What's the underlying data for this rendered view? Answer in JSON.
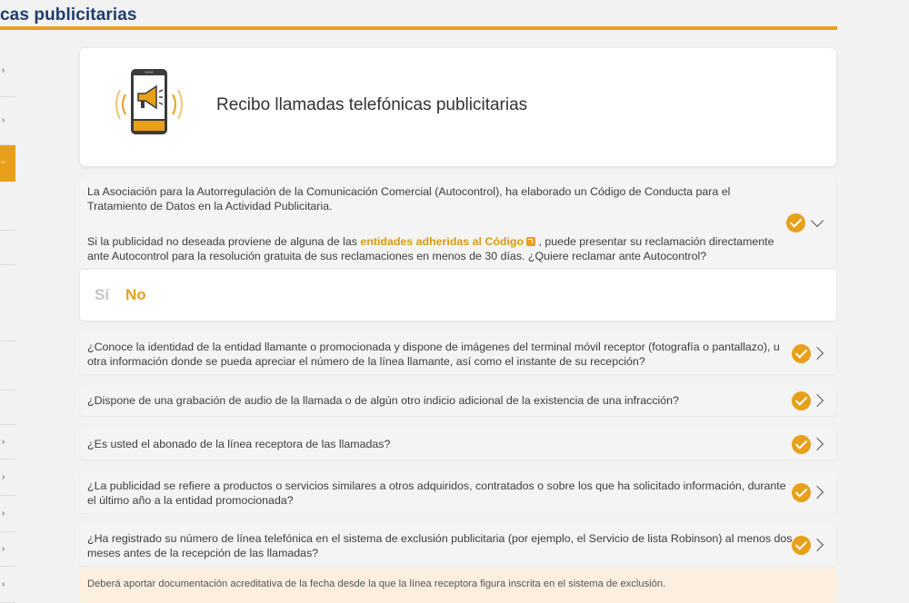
{
  "header": {
    "title": "cas publicitarias"
  },
  "sidebar": {
    "items": [
      {
        "chevron": "›"
      },
      {
        "chevron": "›"
      },
      {
        "chevron": "›",
        "active": true
      },
      {
        "chevron": ""
      },
      {
        "chevron": ""
      },
      {
        "chevron": ""
      },
      {
        "chevron": ""
      },
      {
        "chevron": ""
      },
      {
        "chevron": "›"
      },
      {
        "chevron": "›"
      },
      {
        "chevron": "›"
      },
      {
        "chevron": "›"
      },
      {
        "chevron": "›"
      }
    ]
  },
  "hero": {
    "title": "Recibo llamadas telefónicas publicitarias",
    "icon": "phone-megaphone-icon"
  },
  "intro": {
    "line1": "La Asociación para la Autorregulación de la Comunicación Comercial (Autocontrol), ha elaborado un Código de Conducta para el",
    "line2": "Tratamiento de Datos en la Actividad Publicitaria.",
    "line3_before": "Si la publicidad no deseada proviene de alguna de las ",
    "link": "entidades adheridas al Código",
    "line3_after": " , puede presentar su reclamación directamente",
    "line4": "ante Autocontrol para la resolución gratuita de sus reclamaciones en menos de 30 días. ¿Quiere reclamar ante Autocontrol?"
  },
  "answer": {
    "si": "Sí",
    "no": "No",
    "selected": "No"
  },
  "questions": [
    {
      "line1": "¿Conoce la identidad de la entidad llamante o promocionada y dispone de imágenes del terminal móvil receptor (fotografía o pantallazo), u",
      "line2": "otra información donde se pueda apreciar el número de la línea llamante, así como el instante de su recepción?"
    },
    {
      "line1": "¿Dispone de una grabación de audio de la llamada o de algún otro indicio adicional de la existencia de una infracción?",
      "line2": ""
    },
    {
      "line1": "¿Es usted el abonado de la línea receptora de las llamadas?",
      "line2": ""
    },
    {
      "line1": "¿La publicidad se refiere a productos o servicios similares a otros adquiridos, contratados o sobre los que ha solicitado información, durante",
      "line2": "el último año a la entidad promocionada?"
    },
    {
      "line1": "¿Ha registrado su número de línea telefónica en el sistema de exclusión publicitaria (por ejemplo, el Servicio de lista Robinson) al menos dos",
      "line2": "meses antes de la recepción de las llamadas?"
    }
  ],
  "note": {
    "text": "Deberá aportar documentación acreditativa de la fecha desde la que la línea receptora figura inscrita en el sistema de exclusión."
  },
  "colors": {
    "accent": "#e8a01a",
    "title": "#1f3c6e",
    "note_bg": "#fcefdf"
  }
}
